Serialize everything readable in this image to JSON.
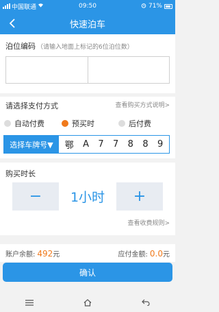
{
  "status_bar": {
    "carrier": "中国联通",
    "time": "09:50",
    "battery": "71%"
  },
  "header": {
    "title": "快速泊车",
    "back_icon": "chevron-left-icon"
  },
  "parking_code": {
    "label": "泊位编码",
    "hint": "（请输入地面上标记的6位泊位数）",
    "boxes": [
      "",
      ""
    ]
  },
  "payment": {
    "label": "请选择支付方式",
    "help_link": "查看购买方式说明>",
    "options": [
      {
        "label": "自动付费",
        "selected": false
      },
      {
        "label": "预买时",
        "selected": true
      },
      {
        "label": "后付费",
        "selected": false
      }
    ]
  },
  "plate": {
    "select_label": "选择车牌号▼",
    "chars": [
      "鄂",
      "A",
      "7",
      "7",
      "8",
      "8",
      "9"
    ]
  },
  "duration": {
    "label": "购买时长",
    "minus": "−",
    "value": "1小时",
    "plus": "+",
    "rules_link": "查看收费规则>"
  },
  "balance": {
    "account_label": "账户余额:",
    "account_value": "492",
    "account_unit": "元",
    "due_label": "应付金额:",
    "due_value": "0.0",
    "due_unit": "元"
  },
  "confirm_label": "确认",
  "colors": {
    "primary": "#2b95e6",
    "accent": "#f07a1c",
    "background": "#f2f2f2"
  },
  "system_nav": {
    "menu_icon": "menu-icon",
    "home_icon": "home-icon",
    "back_icon": "back-arrow-icon"
  }
}
